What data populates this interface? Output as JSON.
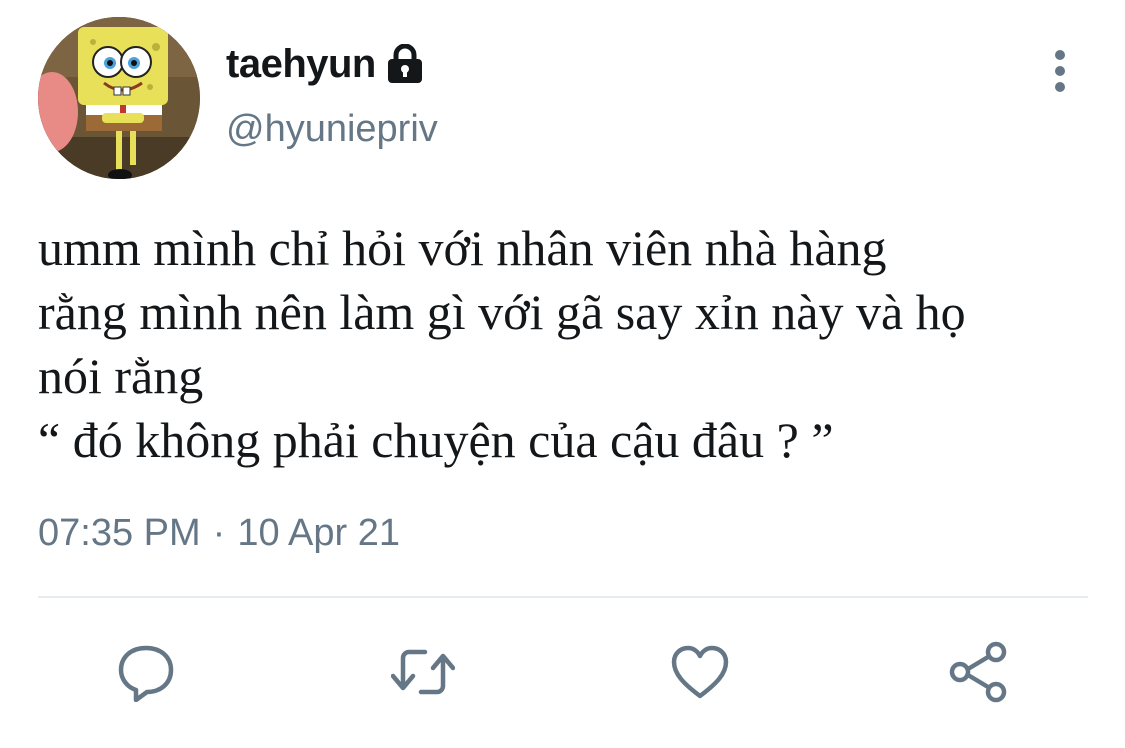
{
  "author": {
    "display_name": "taehyun",
    "handle": "@hyuniepriv",
    "avatar_icon": "spongebob-avatar",
    "protected_icon": "lock-icon"
  },
  "menu": {
    "icon": "more-vertical-icon"
  },
  "tweet": {
    "lines": [
      "umm mình chỉ hỏi với nhân viên nhà hàng",
      "rằng mình nên làm gì với gã say xỉn này và họ",
      "nói rằng",
      "“ đó không phải chuyện của cậu đâu ? ”"
    ],
    "time": "07:35 PM",
    "separator": "·",
    "date": "10 Apr 21"
  },
  "actions": {
    "reply_icon": "reply-icon",
    "retweet_icon": "retweet-icon",
    "like_icon": "heart-icon",
    "share_icon": "share-icon"
  },
  "colors": {
    "text": "#14171a",
    "secondary": "#657786",
    "divider": "#e6ecf0"
  }
}
